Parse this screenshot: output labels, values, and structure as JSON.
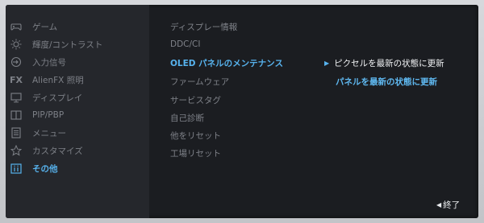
{
  "sidebar": {
    "items": [
      {
        "label": "ゲーム",
        "icon": "gamepad-icon"
      },
      {
        "label": "輝度/コントラスト",
        "icon": "brightness-icon"
      },
      {
        "label": "入力信号",
        "icon": "input-source-icon"
      },
      {
        "label": "AlienFX 照明",
        "icon": "alienfx-icon"
      },
      {
        "label": "ディスプレイ",
        "icon": "monitor-icon"
      },
      {
        "label": "PIP/PBP",
        "icon": "pip-icon"
      },
      {
        "label": "メニュー",
        "icon": "menu-icon"
      },
      {
        "label": "カスタマイズ",
        "icon": "star-icon"
      },
      {
        "label": "その他",
        "icon": "info-icon",
        "active": true
      }
    ]
  },
  "submenu": {
    "items": [
      {
        "label": "ディスプレー情報"
      },
      {
        "label": "DDC/CI"
      },
      {
        "label": "OLED パネルのメンテナンス",
        "active": true
      },
      {
        "label": "ファームウェア"
      },
      {
        "label": "サービスタグ"
      },
      {
        "label": "自己診断"
      },
      {
        "label": "他をリセット"
      },
      {
        "label": "工場リセット"
      }
    ]
  },
  "options": {
    "items": [
      {
        "label": "ピクセルを最新の状態に更新"
      },
      {
        "label": "パネルを最新の状態に更新"
      }
    ]
  },
  "footer": {
    "exit_label": "終了"
  },
  "colors": {
    "accent": "#57b3ee",
    "background": "#1b1d21",
    "sidebar": "#25272c"
  }
}
